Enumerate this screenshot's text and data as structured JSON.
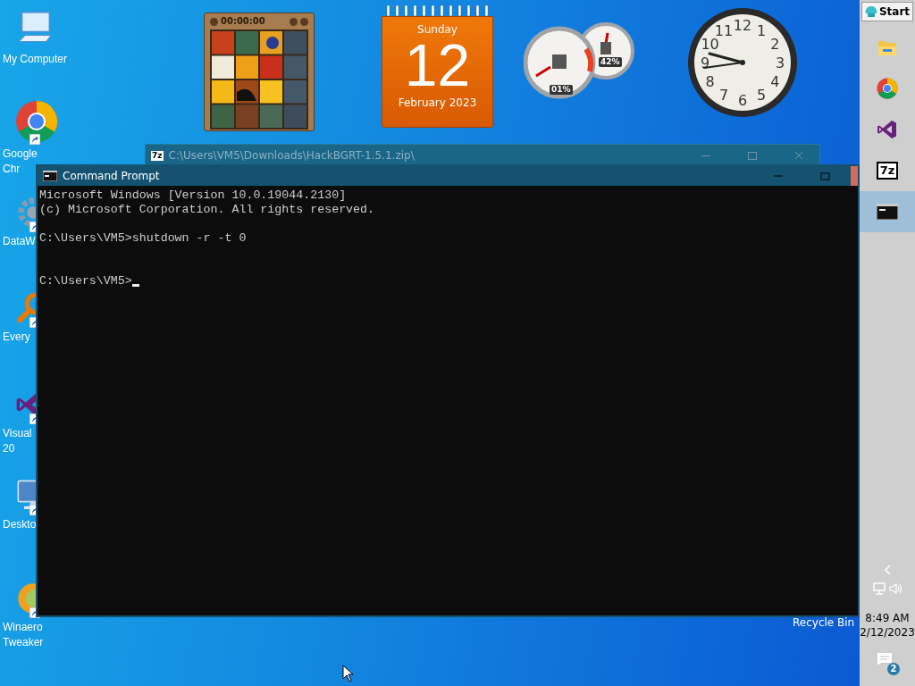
{
  "desktop_icons": [
    {
      "kind": "computer",
      "label": "My Computer"
    },
    {
      "kind": "chrome",
      "label": "Google\nChr"
    },
    {
      "kind": "gear",
      "label": "DataW"
    },
    {
      "kind": "magnifier",
      "label": "Every"
    },
    {
      "kind": "studio",
      "label": "Visual\n20"
    },
    {
      "kind": "monitor",
      "label": "Deskto"
    },
    {
      "kind": "orb",
      "label": "Winaero\nTweaker"
    }
  ],
  "recycle_bin": {
    "label": "Recycle Bin"
  },
  "gadgets": {
    "puzzle": {
      "timer": "00:00:00"
    },
    "calendar": {
      "weekday": "Sunday",
      "day": "12",
      "month_year": "February 2023"
    },
    "meters": {
      "cpu": "01%",
      "memory": "42%"
    },
    "clock": {
      "numbers": [
        "11",
        "12",
        "1",
        "10",
        "2",
        "9",
        "3",
        "8",
        "4",
        "7",
        "6",
        "5"
      ]
    }
  },
  "background_window": {
    "app_glyph": "7z",
    "title": "C:\\Users\\VM5\\Downloads\\HackBGRT-1.5.1.zip\\"
  },
  "console": {
    "title": "Command Prompt",
    "blocks": [
      [
        "Microsoft Windows [Version 10.0.19044.2130]",
        "(c) Microsoft Corporation. All rights reserved."
      ],
      [
        "C:\\Users\\VM5>shutdown -r -t 0"
      ],
      [
        "C:\\Users\\VM5>"
      ]
    ]
  },
  "taskbar": {
    "start": "Start",
    "apps": [
      {
        "kind": "folder",
        "selected": false
      },
      {
        "kind": "chrome",
        "selected": false
      },
      {
        "kind": "studio",
        "selected": false
      },
      {
        "kind": "archive",
        "glyph": "7z",
        "selected": false
      },
      {
        "kind": "console",
        "selected": true
      }
    ],
    "time": "8:49 AM",
    "date": "2/12/2023",
    "notifications": "2"
  }
}
